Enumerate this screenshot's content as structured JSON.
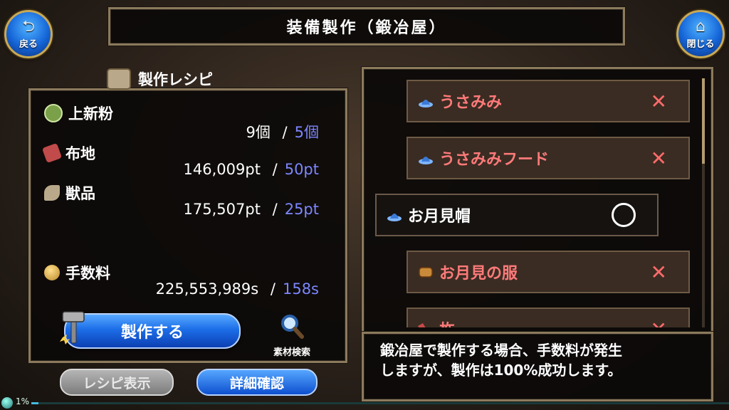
{
  "header": {
    "title": "装備製作（鍛冶屋）",
    "back_label": "戻る",
    "close_label": "閉じる"
  },
  "recipe_panel": {
    "title": "製作レシピ",
    "materials": [
      {
        "name": "上新粉",
        "have": "9個",
        "need": "5個",
        "icon_color": "#7aa04a"
      },
      {
        "name": "布地",
        "have": "146,009pt",
        "need": "50pt",
        "icon_color": "#c14a4a"
      },
      {
        "name": "獣品",
        "have": "175,507pt",
        "need": "25pt",
        "icon_color": "#b9a98a"
      }
    ],
    "fee": {
      "name": "手数料",
      "have": "225,553,989s",
      "need": "158s",
      "icon_color": "#e0b84a"
    },
    "separator": "/",
    "make_button": "製作する",
    "search_label": "素材検索",
    "recipe_view_button": "レシピ表示",
    "detail_button": "詳細確認"
  },
  "recipe_list": {
    "items": [
      {
        "name": "うさみみ",
        "status": "✕",
        "selected": false
      },
      {
        "name": "うさみみフード",
        "status": "✕",
        "selected": false
      },
      {
        "name": "お月見帽",
        "status": "",
        "selected": true
      },
      {
        "name": "お月見の服",
        "status": "✕",
        "selected": false
      },
      {
        "name": "杵",
        "status": "✕",
        "selected": false
      }
    ]
  },
  "info": {
    "line1": "鍛冶屋で製作する場合、手数料が発生",
    "line2": "しますが、製作は100%成功します。"
  },
  "status_bar": {
    "percent_label": "1%",
    "progress": 0.01
  }
}
